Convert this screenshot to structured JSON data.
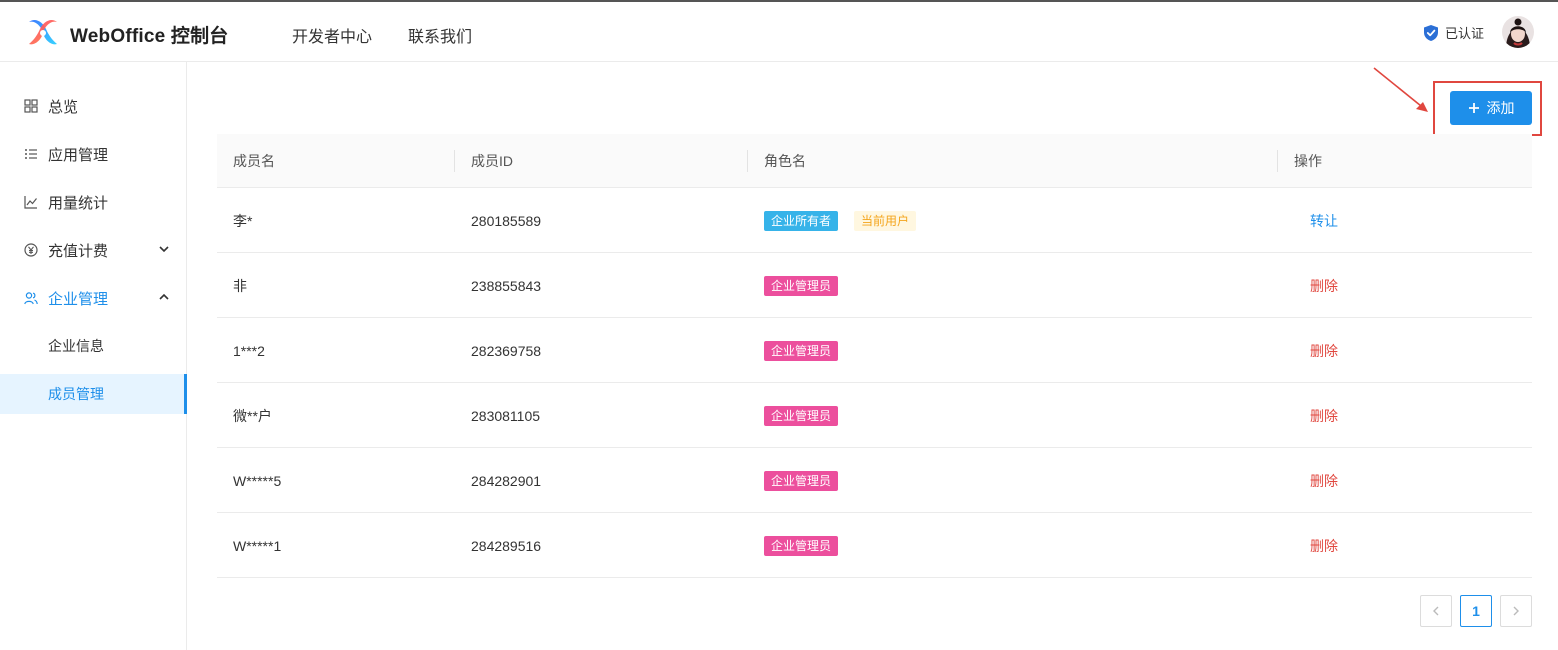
{
  "header": {
    "brand": "WebOffice 控制台",
    "nav": [
      "开发者中心",
      "联系我们"
    ],
    "verified_label": "已认证"
  },
  "sidebar": {
    "items": [
      {
        "label": "总览",
        "icon": "grid-icon"
      },
      {
        "label": "应用管理",
        "icon": "list-icon"
      },
      {
        "label": "用量统计",
        "icon": "line-chart-icon"
      },
      {
        "label": "充值计费",
        "icon": "yen-circle-icon"
      },
      {
        "label": "企业管理",
        "icon": "users-icon"
      }
    ],
    "subitems": [
      "企业信息",
      "成员管理"
    ]
  },
  "toolbar": {
    "add_label": "添加"
  },
  "table": {
    "columns": [
      "成员名",
      "成员ID",
      "角色名",
      "操作"
    ],
    "rows": [
      {
        "name": "李*",
        "id": "280185589",
        "role": "企业所有者",
        "current": "当前用户",
        "action": "转让"
      },
      {
        "name": "非",
        "id": "238855843",
        "role": "企业管理员",
        "action": "删除"
      },
      {
        "name": "1***2",
        "id": "282369758",
        "role": "企业管理员",
        "action": "删除"
      },
      {
        "name": "微**户",
        "id": "283081105",
        "role": "企业管理员",
        "action": "删除"
      },
      {
        "name": "W*****5",
        "id": "284282901",
        "role": "企业管理员",
        "action": "删除"
      },
      {
        "name": "W*****1",
        "id": "284289516",
        "role": "企业管理员",
        "action": "删除"
      }
    ]
  },
  "pagination": {
    "current_page": "1"
  },
  "colors": {
    "primary": "#1e8fea",
    "danger": "#e0473f",
    "owner_tag": "#36b3e9",
    "admin_tag": "#ec4f9d",
    "current_tag_text": "#f4a51c"
  }
}
